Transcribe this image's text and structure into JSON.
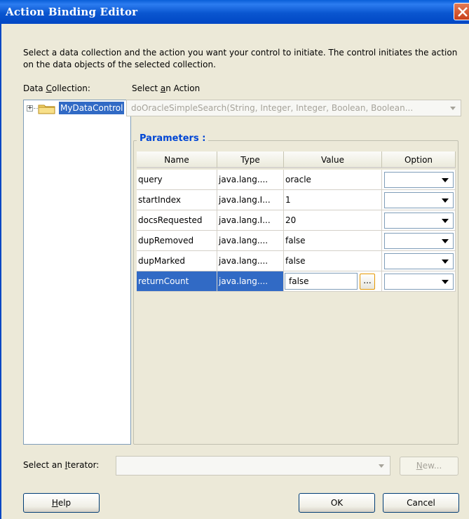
{
  "window": {
    "title": "Action Binding Editor"
  },
  "description": "Select a data collection and the action you want your control to initiate. The control initiates the action on the data objects of the selected collection.",
  "data_collection": {
    "label_pre": "Data ",
    "label_key": "C",
    "label_post": "ollection:",
    "tree_item": "MyDataControl",
    "expander": "+"
  },
  "action": {
    "label_pre": "Select ",
    "label_key": "a",
    "label_post": "n Action",
    "value": "doOracleSimpleSearch(String, Integer, Integer, Boolean, Boolean..."
  },
  "parameters": {
    "title": "Parameters :",
    "columns": [
      "Name",
      "Type",
      "Value",
      "Option"
    ],
    "rows": [
      {
        "name": "query",
        "type": "java.lang....",
        "value": "oracle"
      },
      {
        "name": "startIndex",
        "type": "java.lang.I...",
        "value": "1"
      },
      {
        "name": "docsRequested",
        "type": "java.lang.I...",
        "value": "20"
      },
      {
        "name": "dupRemoved",
        "type": "java.lang....",
        "value": "false"
      },
      {
        "name": "dupMarked",
        "type": "java.lang....",
        "value": "false"
      },
      {
        "name": "returnCount",
        "type": "java.lang....",
        "value": "false",
        "selected": true
      }
    ],
    "ellipsis_label": "..."
  },
  "iterator": {
    "label_pre": "Select an ",
    "label_key": "I",
    "label_post": "terator:",
    "value": ""
  },
  "buttons": {
    "new_key": "N",
    "new_rest": "ew...",
    "help_key": "H",
    "help_rest": "elp",
    "ok": "OK",
    "cancel": "Cancel"
  },
  "colors": {
    "titlebar": "#0a56d0",
    "dialog_bg": "#ece9d8",
    "selection": "#316ac5",
    "group_title": "#0046d5"
  }
}
